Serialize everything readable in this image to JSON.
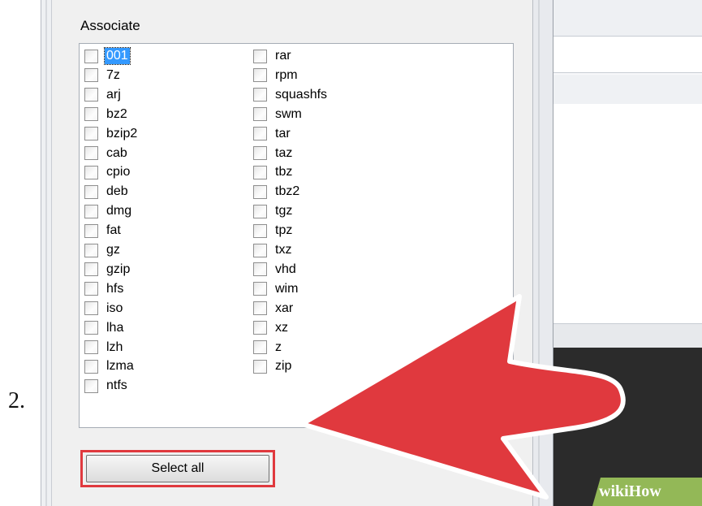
{
  "step_number": "2.",
  "dialog": {
    "group_label": "Associate",
    "column1": [
      {
        "label": "001",
        "checked": false,
        "selected": true
      },
      {
        "label": "7z",
        "checked": false
      },
      {
        "label": "arj",
        "checked": false
      },
      {
        "label": "bz2",
        "checked": false
      },
      {
        "label": "bzip2",
        "checked": false
      },
      {
        "label": "cab",
        "checked": false
      },
      {
        "label": "cpio",
        "checked": false
      },
      {
        "label": "deb",
        "checked": false
      },
      {
        "label": "dmg",
        "checked": false
      },
      {
        "label": "fat",
        "checked": false
      },
      {
        "label": "gz",
        "checked": false
      },
      {
        "label": "gzip",
        "checked": false
      },
      {
        "label": "hfs",
        "checked": false
      },
      {
        "label": "iso",
        "checked": false
      },
      {
        "label": "lha",
        "checked": false
      },
      {
        "label": "lzh",
        "checked": false
      },
      {
        "label": "lzma",
        "checked": false
      },
      {
        "label": "ntfs",
        "checked": false
      }
    ],
    "column2": [
      {
        "label": "rar",
        "checked": false
      },
      {
        "label": "rpm",
        "checked": false
      },
      {
        "label": "squashfs",
        "checked": false
      },
      {
        "label": "swm",
        "checked": false
      },
      {
        "label": "tar",
        "checked": false
      },
      {
        "label": "taz",
        "checked": false
      },
      {
        "label": "tbz",
        "checked": false
      },
      {
        "label": "tbz2",
        "checked": false
      },
      {
        "label": "tgz",
        "checked": false
      },
      {
        "label": "tpz",
        "checked": false
      },
      {
        "label": "txz",
        "checked": false
      },
      {
        "label": "vhd",
        "checked": false
      },
      {
        "label": "wim",
        "checked": false
      },
      {
        "label": "xar",
        "checked": false
      },
      {
        "label": "xz",
        "checked": false
      },
      {
        "label": "z",
        "checked": false
      },
      {
        "label": "zip",
        "checked": false
      }
    ],
    "select_all_label": "Select all"
  },
  "watermark": {
    "text": "wikiHow"
  },
  "colors": {
    "arrow": "#e0393e",
    "highlight_frame": "#e0393e",
    "selection": "#3399ff"
  }
}
